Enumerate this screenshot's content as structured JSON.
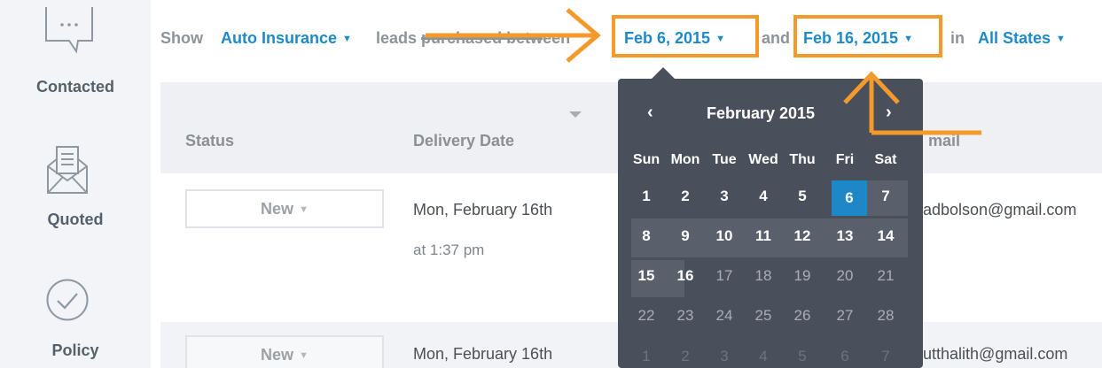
{
  "sidebar": {
    "items": [
      {
        "label": "Contacted",
        "icon": "chat-bubble-icon"
      },
      {
        "label": "Quoted",
        "icon": "envelope-document-icon"
      },
      {
        "label": "Policy",
        "icon": "checkmark-circle-icon"
      }
    ]
  },
  "filter": {
    "show": "Show",
    "product": "Auto Insurance",
    "leads_text": "leads",
    "purchased_text": "purchased betw",
    "purchased_tail": "een",
    "start_date": "Feb 6, 2015",
    "and": "and",
    "end_date": "Feb 16, 2015",
    "in": "in",
    "states": "All States"
  },
  "table": {
    "columns": [
      "Status",
      "Delivery Date",
      "mail"
    ],
    "rows": [
      {
        "status": "New",
        "delivery_date": "Mon, February 16th",
        "delivery_time": "at 1:37 pm",
        "email": "adbolson@gmail.com"
      },
      {
        "status": "New",
        "delivery_date": "Mon, February 16th",
        "email": "utthalith@gmail.com"
      }
    ]
  },
  "calendar": {
    "month_label": "February 2015",
    "prev_label": "‹",
    "next_label": "›",
    "weekdays": [
      "Sun",
      "Mon",
      "Tue",
      "Wed",
      "Thu",
      "Fri",
      "Sat"
    ],
    "weeks": [
      [
        "1",
        "2",
        "3",
        "4",
        "5",
        "6",
        "7"
      ],
      [
        "8",
        "9",
        "10",
        "11",
        "12",
        "13",
        "14"
      ],
      [
        "15",
        "16",
        "17",
        "18",
        "19",
        "20",
        "21"
      ],
      [
        "22",
        "23",
        "24",
        "25",
        "26",
        "27",
        "28"
      ],
      [
        "1",
        "2",
        "3",
        "4",
        "5",
        "6",
        "7"
      ]
    ],
    "selected_start": "6",
    "selected_end": "16"
  },
  "colors": {
    "accent": "#1d8ac9",
    "annotation": "#f49a2b",
    "calendar_bg": "#4a4f5c"
  }
}
